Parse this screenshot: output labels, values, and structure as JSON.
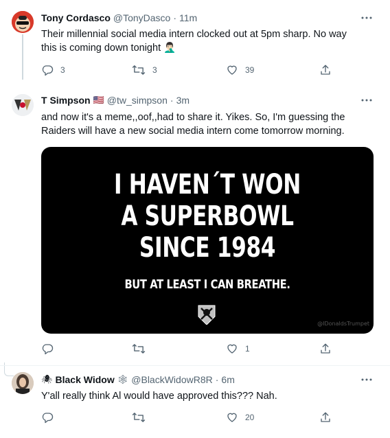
{
  "tweets": [
    {
      "name": "Tony Cordasco",
      "handle": "@TonyDasco",
      "dot": "·",
      "time": "11m",
      "text": "Their millennial social media intern clocked out at 5pm sharp. No way this is coming down tonight 🤦🏻‍♂️",
      "replies": "3",
      "retweets": "3",
      "likes": "39"
    },
    {
      "name": "T Simpson",
      "flag": "🇺🇸",
      "handle": "@tw_simpson",
      "dot": "·",
      "time": "3m",
      "text": "and now it's a meme,,oof,,had to share it.  Yikes. So, I'm guessing the Raiders will have a new social media intern come tomorrow morning.",
      "replies": "",
      "retweets": "",
      "likes": "1"
    },
    {
      "name_prefix": "🕷",
      "name": "Black Widow",
      "name_suffix": "🕸",
      "handle": "@BlackWidowR8R",
      "dot": "·",
      "time": "6m",
      "text": "Y'all really think Al would have approved this??? Nah.",
      "replies": "",
      "retweets": "",
      "likes": "20"
    }
  ],
  "meme": {
    "line1": "I HAVEN´T WON",
    "line2": "A SUPERBOWL",
    "line3": "SINCE 1984",
    "line4": "BUT AT LEAST I CAN BREATHE.",
    "watermark": "@IDonaldsTrumpet"
  },
  "colors": {
    "text": "#0f1419",
    "muted": "#536471",
    "thread_line": "#cfd9de",
    "divider": "#eff3f4"
  },
  "icons": [
    "more-icon",
    "reply-icon",
    "retweet-icon",
    "like-icon",
    "share-icon"
  ]
}
